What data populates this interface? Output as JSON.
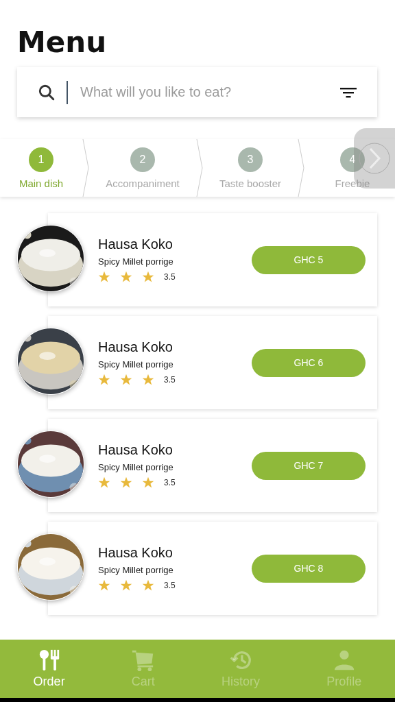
{
  "title": "Menu",
  "search": {
    "placeholder": "What will you like to eat?"
  },
  "steps": [
    {
      "number": "1",
      "label": "Main dish",
      "selected": true
    },
    {
      "number": "2",
      "label": "Accompaniment",
      "selected": false
    },
    {
      "number": "3",
      "label": "Taste booster",
      "selected": false
    },
    {
      "number": "4",
      "label": "Freebie",
      "selected": false
    }
  ],
  "items": [
    {
      "name": "Hausa Koko",
      "description": "Spicy Millet porrige",
      "stars": 3,
      "rating": "3.5",
      "price": "GHC 5"
    },
    {
      "name": "Hausa Koko",
      "description": "Spicy Millet porrige",
      "stars": 3,
      "rating": "3.5",
      "price": "GHC 6"
    },
    {
      "name": "Hausa Koko",
      "description": "Spicy Millet porrige",
      "stars": 3,
      "rating": "3.5",
      "price": "GHC 7"
    },
    {
      "name": "Hausa Koko",
      "description": "Spicy Millet porrige",
      "stars": 3,
      "rating": "3.5",
      "price": "GHC 8"
    }
  ],
  "nav": [
    {
      "label": "Order",
      "kind": "cutlery",
      "selected": true
    },
    {
      "label": "Cart",
      "kind": "cart",
      "selected": false
    },
    {
      "label": "History",
      "kind": "history",
      "selected": false
    },
    {
      "label": "Profile",
      "kind": "person",
      "selected": false
    }
  ]
}
